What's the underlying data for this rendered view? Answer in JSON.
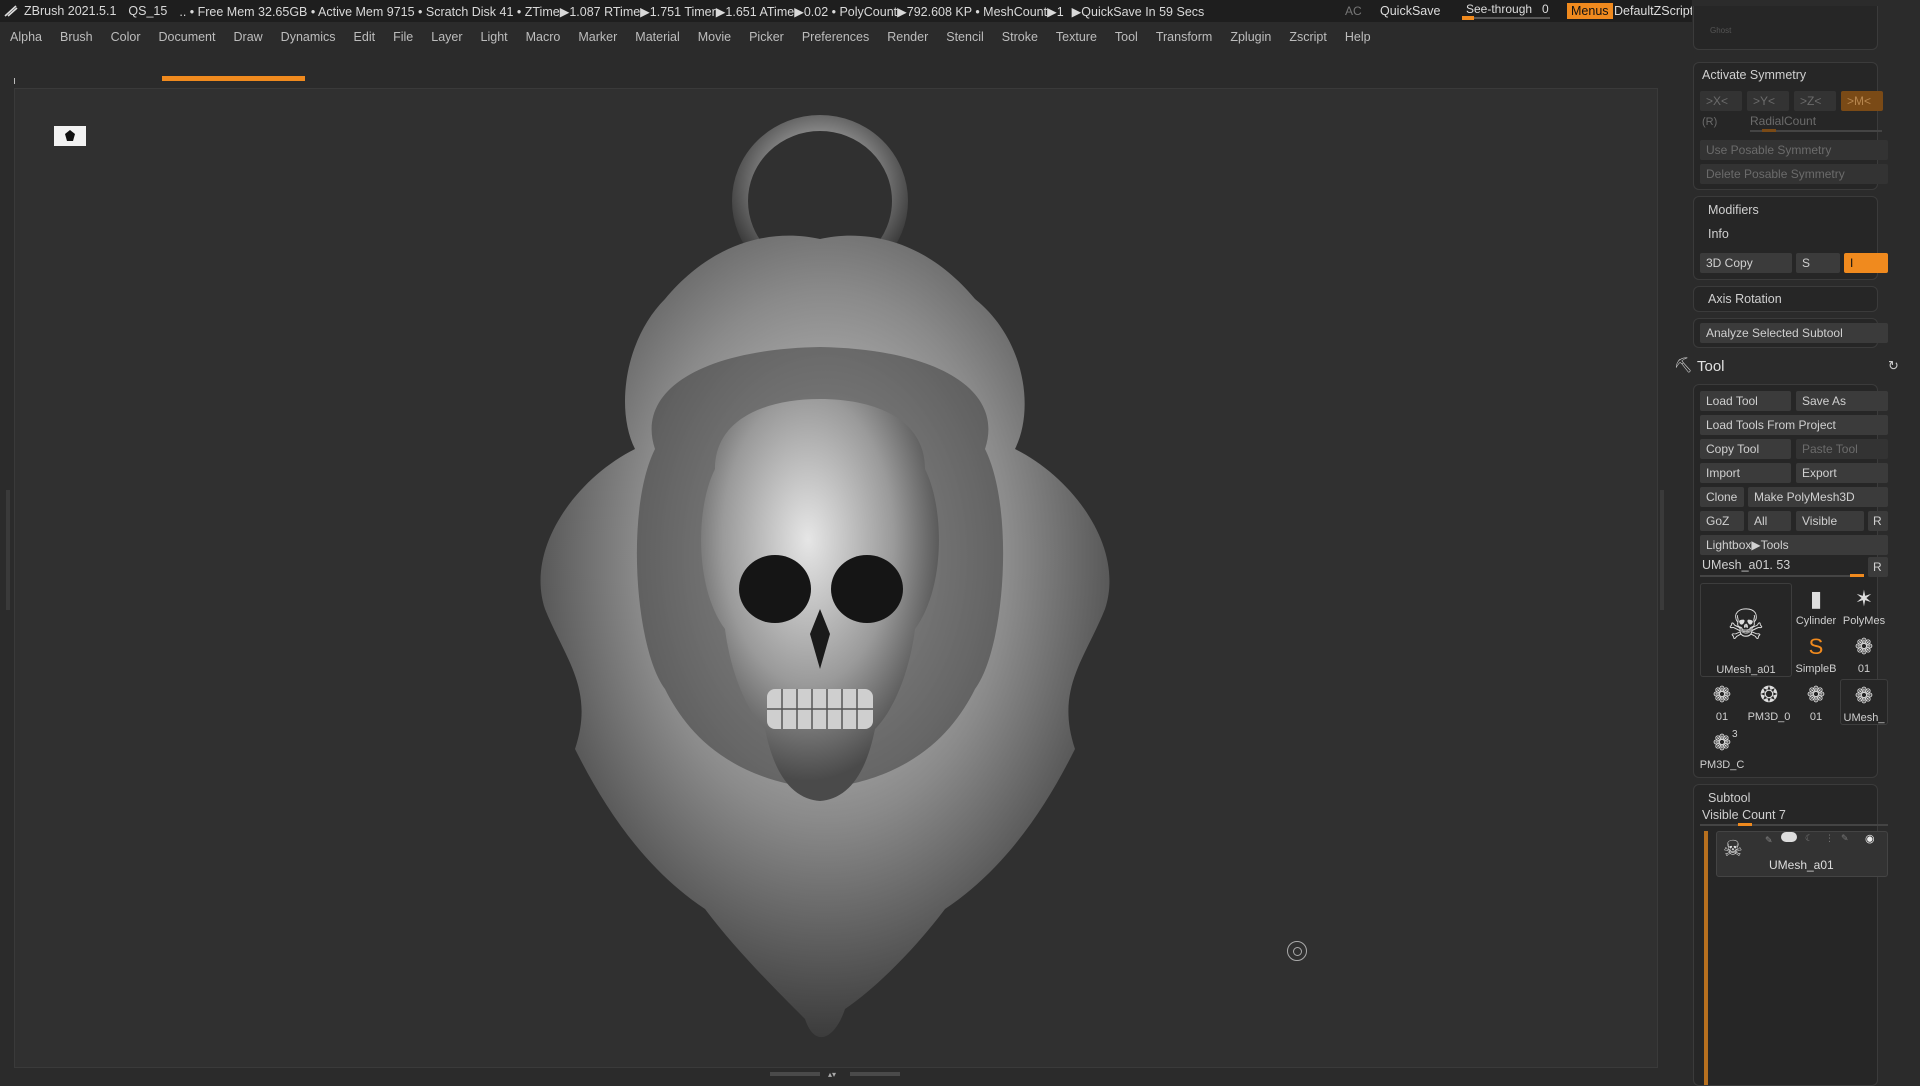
{
  "titlebar": {
    "app": "ZBrush 2021.5.1",
    "project": "QS_15",
    "stats": ".. • Free Mem 32.65GB • Active Mem 9715 • Scratch Disk 41 • ZTime▶1.087 RTime▶1.751 Timer▶1.651 ATime▶0.02 • PolyCount▶792.608 KP • MeshCount▶1",
    "quicksave_timer": "▶QuickSave In 59 Secs",
    "ac": "AC",
    "quicksave": "QuickSave",
    "see_through": "See-through",
    "see_through_value": "0",
    "menus": "Menus",
    "script": "DefaultZScript"
  },
  "menubar": [
    "Alpha",
    "Brush",
    "Color",
    "Document",
    "Draw",
    "Dynamics",
    "Edit",
    "File",
    "Layer",
    "Light",
    "Macro",
    "Marker",
    "Material",
    "Movie",
    "Picker",
    "Preferences",
    "Render",
    "Stencil",
    "Stroke",
    "Texture",
    "Tool",
    "Transform",
    "Zplugin",
    "Zscript",
    "Help"
  ],
  "right": {
    "ghost": "Ghost",
    "activate_symmetry": "Activate Symmetry",
    "sym_x": ">X<",
    "sym_y": ">Y<",
    "sym_z": ">Z<",
    "sym_m": ">M<",
    "r": "(R)",
    "radial_count": "RadialCount",
    "use_posable": "Use Posable Symmetry",
    "delete_posable": "Delete Posable Symmetry",
    "modifiers": "Modifiers",
    "info": "Info",
    "copy3d": "3D Copy",
    "s": "S",
    "i": "I",
    "axis_rotation": "Axis Rotation",
    "analyze": "Analyze Selected Subtool",
    "tool_title": "Tool",
    "load_tool": "Load Tool",
    "save_as": "Save As",
    "load_from_project": "Load Tools From Project",
    "copy_tool": "Copy Tool",
    "paste_tool": "Paste Tool",
    "import": "Import",
    "export": "Export",
    "clone": "Clone",
    "make_polymesh": "Make PolyMesh3D",
    "goz": "GoZ",
    "all": "All",
    "visible": "Visible",
    "r_btn": "R",
    "lightbox_tools": "Lightbox▶Tools",
    "current_tool": "UMesh_a01. 53",
    "current_tool_r": "R",
    "thumbs": [
      "UMesh_a01",
      "Cylinder",
      "PolyMes",
      "SimpleB",
      "01",
      "01",
      "PM3D_0",
      "01",
      "UMesh_",
      "PM3D_C"
    ],
    "thumb_small_3": "3",
    "subtool_title": "Subtool",
    "visible_count": "Visible Count 7",
    "subtool_item": "UMesh_a01"
  },
  "colors": {
    "accent": "#f08a1e",
    "bg": "#2b2b2b",
    "viewport": "#303030"
  }
}
